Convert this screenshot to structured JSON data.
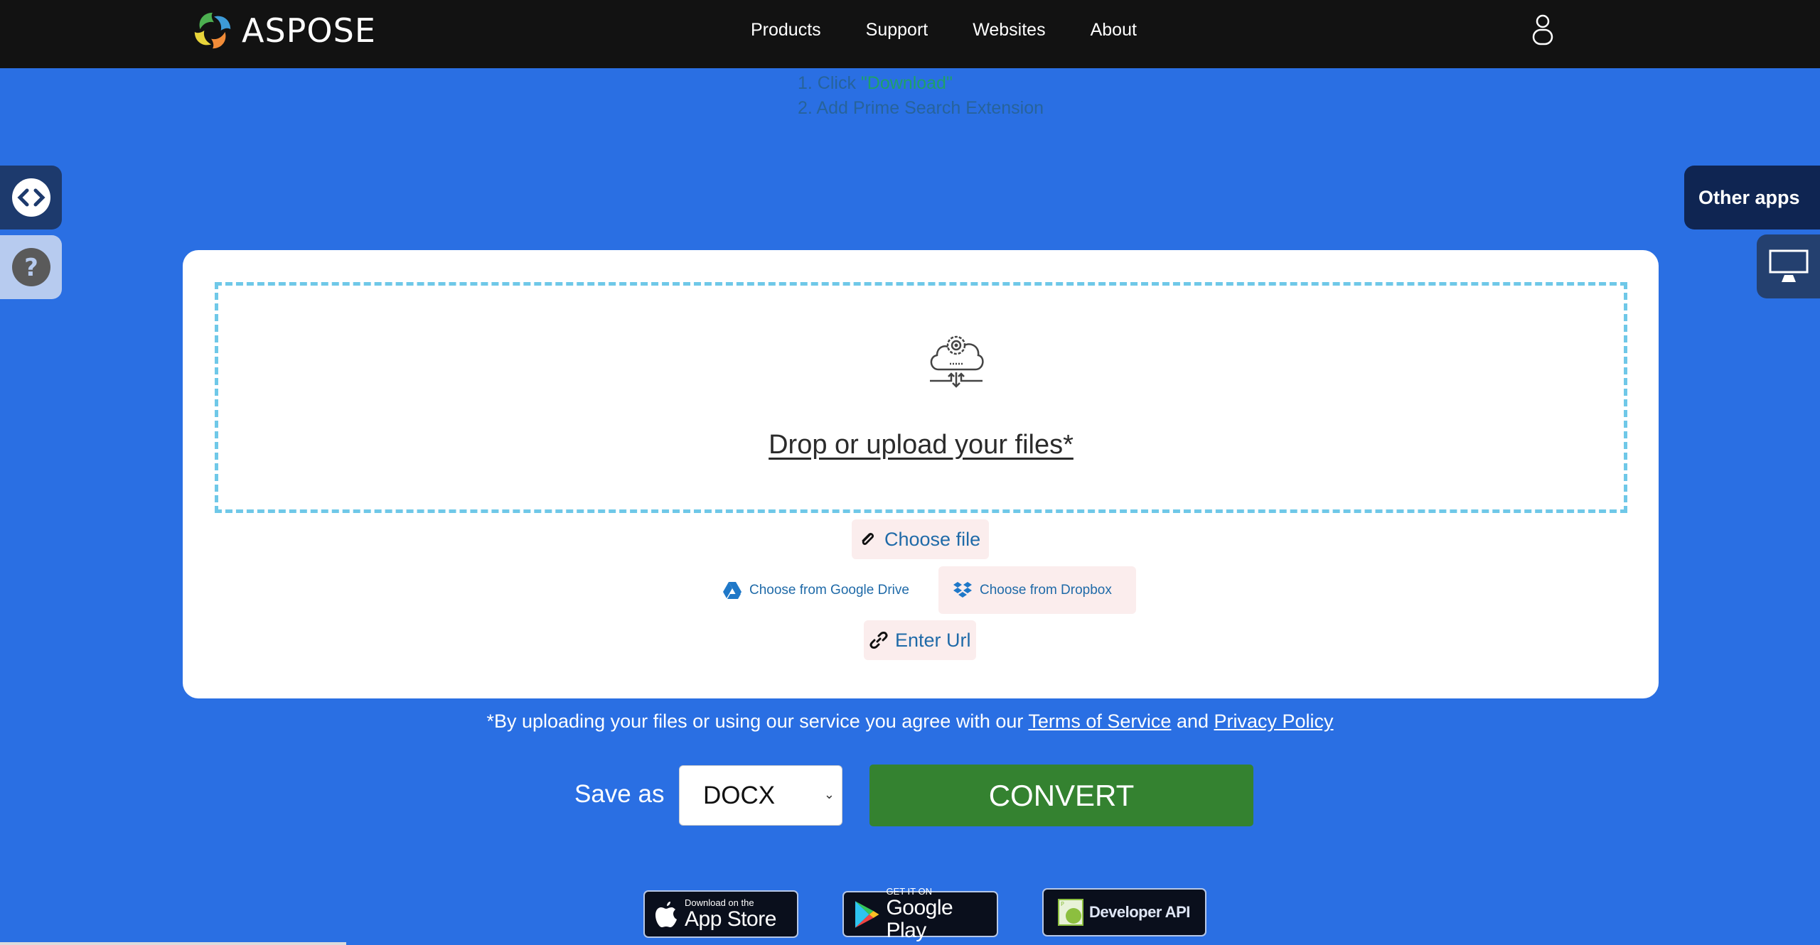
{
  "header": {
    "logo_text": "ASPOSE",
    "nav": [
      "Products",
      "Support",
      "Websites",
      "About"
    ],
    "user_icon": "user-icon"
  },
  "instructions": {
    "line1_prefix": "1. Click ",
    "line1_highlight": "\"Download\"",
    "line2": "2. Add Prime Search Extension"
  },
  "side": {
    "embed_icon": "code-icon",
    "help_icon": "question-icon",
    "other_apps_label": "Other apps",
    "desktop_icon": "monitor-icon"
  },
  "upload": {
    "drop_text": "Drop or upload your files*",
    "choose_file": "Choose file",
    "google_drive": "Choose from Google Drive",
    "dropbox": "Choose from Dropbox",
    "enter_url": "Enter Url"
  },
  "terms": {
    "prefix": "*By uploading your files or using our service you agree with our ",
    "tos": "Terms of Service",
    "and": " and ",
    "privacy": "Privacy Policy"
  },
  "convert": {
    "save_as_label": "Save as",
    "format_value": "DOCX",
    "button_label": "CONVERT"
  },
  "badges": {
    "appstore_small": "Download on the",
    "appstore_big": "App Store",
    "googleplay_small": "GET IT ON",
    "googleplay_big": "Google Play",
    "devapi": "Developer API"
  },
  "colors": {
    "background": "#2a6fe3",
    "header": "#121212",
    "convert": "#348230",
    "link": "#1f6aa8",
    "dropzone_border": "#6fc8e8"
  }
}
